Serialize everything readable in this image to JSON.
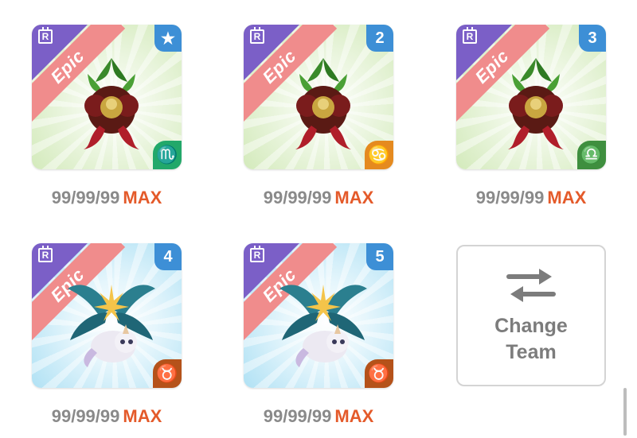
{
  "team": [
    {
      "slot": "star-icon",
      "slot_label": "★",
      "rarity": "Epic",
      "theme": "green",
      "creature_icon": "holly-wreath-creature",
      "zodiac": "Scorpio",
      "zodiac_symbol": "♏",
      "zodiac_color": "#22a86a",
      "level": "99/99/99",
      "max": "MAX"
    },
    {
      "slot_label": "2",
      "rarity": "Epic",
      "theme": "green",
      "creature_icon": "holly-wreath-creature",
      "zodiac": "Cancer",
      "zodiac_symbol": "♋",
      "zodiac_color": "#e58a1f",
      "level": "99/99/99",
      "max": "MAX"
    },
    {
      "slot_label": "3",
      "rarity": "Epic",
      "theme": "green",
      "creature_icon": "holly-wreath-creature",
      "zodiac": "Libra",
      "zodiac_symbol": "♎",
      "zodiac_color": "#3f8f3f",
      "level": "99/99/99",
      "max": "MAX"
    },
    {
      "slot_label": "4",
      "rarity": "Epic",
      "theme": "blue",
      "creature_icon": "flower-unicorn-cat-creature",
      "zodiac": "Taurus",
      "zodiac_symbol": "♉",
      "zodiac_color": "#b5521a",
      "level": "99/99/99",
      "max": "MAX"
    },
    {
      "slot_label": "5",
      "rarity": "Epic",
      "theme": "blue",
      "creature_icon": "flower-unicorn-cat-creature",
      "zodiac": "Taurus",
      "zodiac_symbol": "♉",
      "zodiac_color": "#b5521a",
      "level": "99/99/99",
      "max": "MAX"
    }
  ],
  "change_team": {
    "icon": "swap-arrows-icon",
    "line1": "Change",
    "line2": "Team"
  },
  "colors": {
    "max_accent": "#e45a2a",
    "slot_badge": "#3d8fd6",
    "rarity_ribbon": "#f08c8c",
    "rarity_corner": "#7b5fc7"
  }
}
